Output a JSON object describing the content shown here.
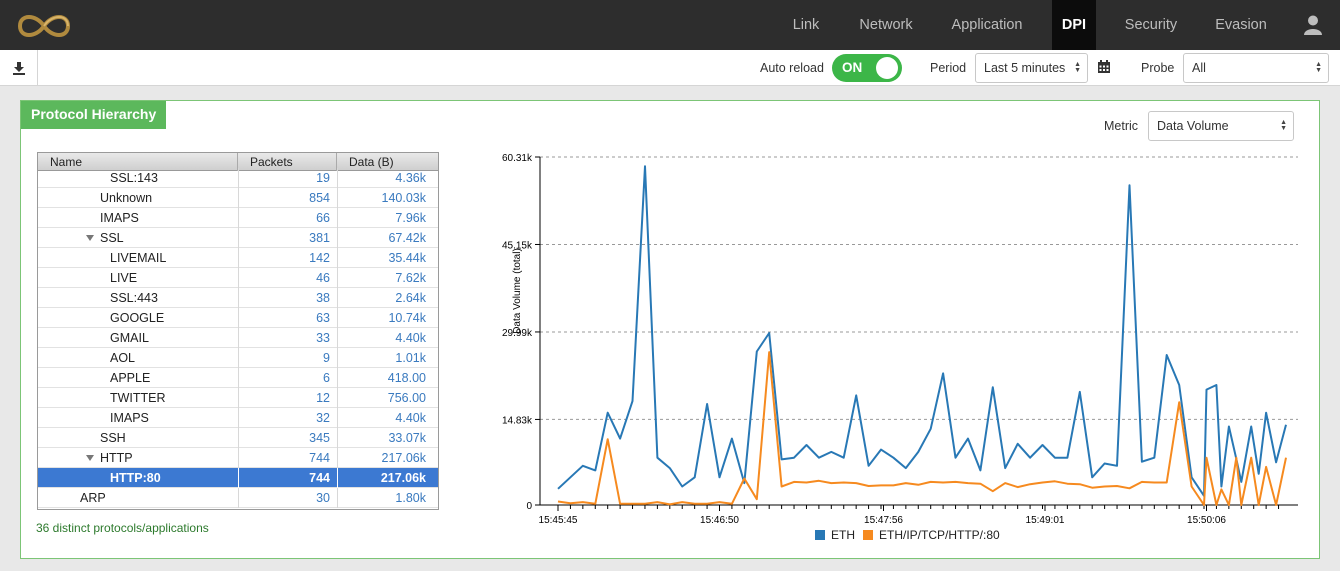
{
  "nav": {
    "items": [
      {
        "label": "Link",
        "active": false
      },
      {
        "label": "Network",
        "active": false
      },
      {
        "label": "Application",
        "active": false
      },
      {
        "label": "DPI",
        "active": true
      },
      {
        "label": "Security",
        "active": false
      },
      {
        "label": "Evasion",
        "active": false
      }
    ],
    "user_icon": "user-icon",
    "logo_icon": "infinity-logo-icon"
  },
  "toolbar": {
    "download_icon": "download-icon",
    "auto_reload_label": "Auto reload",
    "auto_reload_state": "ON",
    "period_label": "Period",
    "period_value": "Last 5 minutes",
    "calendar_icon": "calendar-icon",
    "probe_label": "Probe",
    "probe_value": "All"
  },
  "panel": {
    "title": "Protocol Hierarchy",
    "metric_label": "Metric",
    "metric_value": "Data Volume",
    "distinct_text": "36 distinct protocols/applications"
  },
  "tree": {
    "columns": [
      "Name",
      "Packets",
      "Data (B)"
    ],
    "rows": [
      {
        "name": "SSL:143",
        "depth": 3,
        "packets": "19",
        "data": "4.36k",
        "expander": "none",
        "selected": false
      },
      {
        "name": "Unknown",
        "depth": 2,
        "packets": "854",
        "data": "140.03k",
        "expander": "none",
        "selected": false
      },
      {
        "name": "IMAPS",
        "depth": 2,
        "packets": "66",
        "data": "7.96k",
        "expander": "none",
        "selected": false
      },
      {
        "name": "SSL",
        "depth": 2,
        "packets": "381",
        "data": "67.42k",
        "expander": "expanded",
        "selected": false
      },
      {
        "name": "LIVEMAIL",
        "depth": 3,
        "packets": "142",
        "data": "35.44k",
        "expander": "none",
        "selected": false
      },
      {
        "name": "LIVE",
        "depth": 3,
        "packets": "46",
        "data": "7.62k",
        "expander": "none",
        "selected": false
      },
      {
        "name": "SSL:443",
        "depth": 3,
        "packets": "38",
        "data": "2.64k",
        "expander": "none",
        "selected": false
      },
      {
        "name": "GOOGLE",
        "depth": 3,
        "packets": "63",
        "data": "10.74k",
        "expander": "none",
        "selected": false
      },
      {
        "name": "GMAIL",
        "depth": 3,
        "packets": "33",
        "data": "4.40k",
        "expander": "none",
        "selected": false
      },
      {
        "name": "AOL",
        "depth": 3,
        "packets": "9",
        "data": "1.01k",
        "expander": "none",
        "selected": false
      },
      {
        "name": "APPLE",
        "depth": 3,
        "packets": "6",
        "data": "418.00",
        "expander": "none",
        "selected": false
      },
      {
        "name": "TWITTER",
        "depth": 3,
        "packets": "12",
        "data": "756.00",
        "expander": "none",
        "selected": false
      },
      {
        "name": "IMAPS",
        "depth": 3,
        "packets": "32",
        "data": "4.40k",
        "expander": "none",
        "selected": false
      },
      {
        "name": "SSH",
        "depth": 2,
        "packets": "345",
        "data": "33.07k",
        "expander": "none",
        "selected": false
      },
      {
        "name": "HTTP",
        "depth": 2,
        "packets": "744",
        "data": "217.06k",
        "expander": "expanded",
        "selected": false
      },
      {
        "name": "HTTP:80",
        "depth": 3,
        "packets": "744",
        "data": "217.06k",
        "expander": "none",
        "selected": true
      },
      {
        "name": "ARP",
        "depth": 1,
        "packets": "30",
        "data": "1.80k",
        "expander": "none",
        "selected": false
      }
    ]
  },
  "chart_data": {
    "type": "line",
    "ylabel": "Data Volume (total)",
    "y_ticks": [
      "0",
      "14.83k",
      "29.99k",
      "45.15k",
      "60.31k"
    ],
    "y_tick_values": [
      0,
      14830,
      29990,
      45150,
      60310
    ],
    "ylim": [
      0,
      60310
    ],
    "x_ticks": [
      "15:45:45",
      "15:46:50",
      "15:47:56",
      "15:49:01",
      "15:50:06"
    ],
    "grid": "horizontal dashed",
    "legend_position": "bottom",
    "colors": {
      "eth": "#2878b5",
      "http": "#f68a1f"
    },
    "series": [
      {
        "name": "ETH",
        "color": "#2878b5",
        "values": [
          2800,
          4800,
          6800,
          6000,
          16000,
          11500,
          18000,
          58700,
          8200,
          6400,
          3200,
          4800,
          17500,
          4800,
          11500,
          3800,
          26600,
          29800,
          7900,
          8200,
          10400,
          8200,
          9200,
          8200,
          19000,
          6800,
          9600,
          8200,
          6400,
          9200,
          13200,
          22800,
          8200,
          11500,
          6000,
          20400,
          6400,
          10600,
          8200,
          10400,
          8200,
          8200,
          19600,
          4800,
          7200,
          6800,
          55400,
          7500,
          8200,
          26000,
          20800,
          4800,
          1600,
          20000,
          20800,
          3200,
          13600,
          8000,
          4000,
          13600,
          5400,
          16000,
          7400,
          13900
        ],
        "x_times": [
          "15:45:45",
          "15:45:50",
          "15:45:55",
          "15:46:00",
          "15:46:05",
          "15:46:10",
          "15:46:15",
          "15:46:20",
          "15:46:25",
          "15:46:30",
          "15:46:35",
          "15:46:40",
          "15:46:45",
          "15:46:50",
          "15:46:55",
          "15:47:00",
          "15:47:05",
          "15:47:10",
          "15:47:15",
          "15:47:20",
          "15:47:25",
          "15:47:30",
          "15:47:35",
          "15:47:40",
          "15:47:45",
          "15:47:50",
          "15:47:55",
          "15:48:00",
          "15:48:05",
          "15:48:10",
          "15:48:15",
          "15:48:20",
          "15:48:25",
          "15:48:30",
          "15:48:35",
          "15:48:40",
          "15:48:45",
          "15:48:50",
          "15:48:55",
          "15:49:00",
          "15:49:05",
          "15:49:10",
          "15:49:15",
          "15:49:20",
          "15:49:25",
          "15:49:30",
          "15:49:35",
          "15:49:40",
          "15:49:45",
          "15:49:50",
          "15:49:55",
          "15:50:00",
          "15:50:05",
          "15:50:06",
          "15:50:10",
          "15:50:12",
          "15:50:15",
          "15:50:18",
          "15:50:20",
          "15:50:24",
          "15:50:27",
          "15:50:30",
          "15:50:34",
          "15:50:38"
        ]
      },
      {
        "name": "ETH/IP/TCP/HTTP/:80",
        "color": "#f68a1f",
        "values": [
          600,
          300,
          500,
          200,
          11400,
          200,
          200,
          200,
          500,
          100,
          500,
          200,
          200,
          500,
          200,
          4600,
          1000,
          26500,
          3200,
          4000,
          3900,
          4200,
          3800,
          3900,
          3800,
          3300,
          3400,
          3400,
          3800,
          3500,
          4000,
          3900,
          4000,
          3800,
          3700,
          2400,
          3800,
          3100,
          3600,
          3900,
          4100,
          3700,
          3600,
          3000,
          3200,
          3300,
          2900,
          4000,
          3900,
          3900,
          17800,
          3200,
          0,
          8200,
          0,
          2700,
          0,
          8200,
          0,
          8200,
          0,
          6600,
          0,
          8200
        ]
      }
    ]
  }
}
